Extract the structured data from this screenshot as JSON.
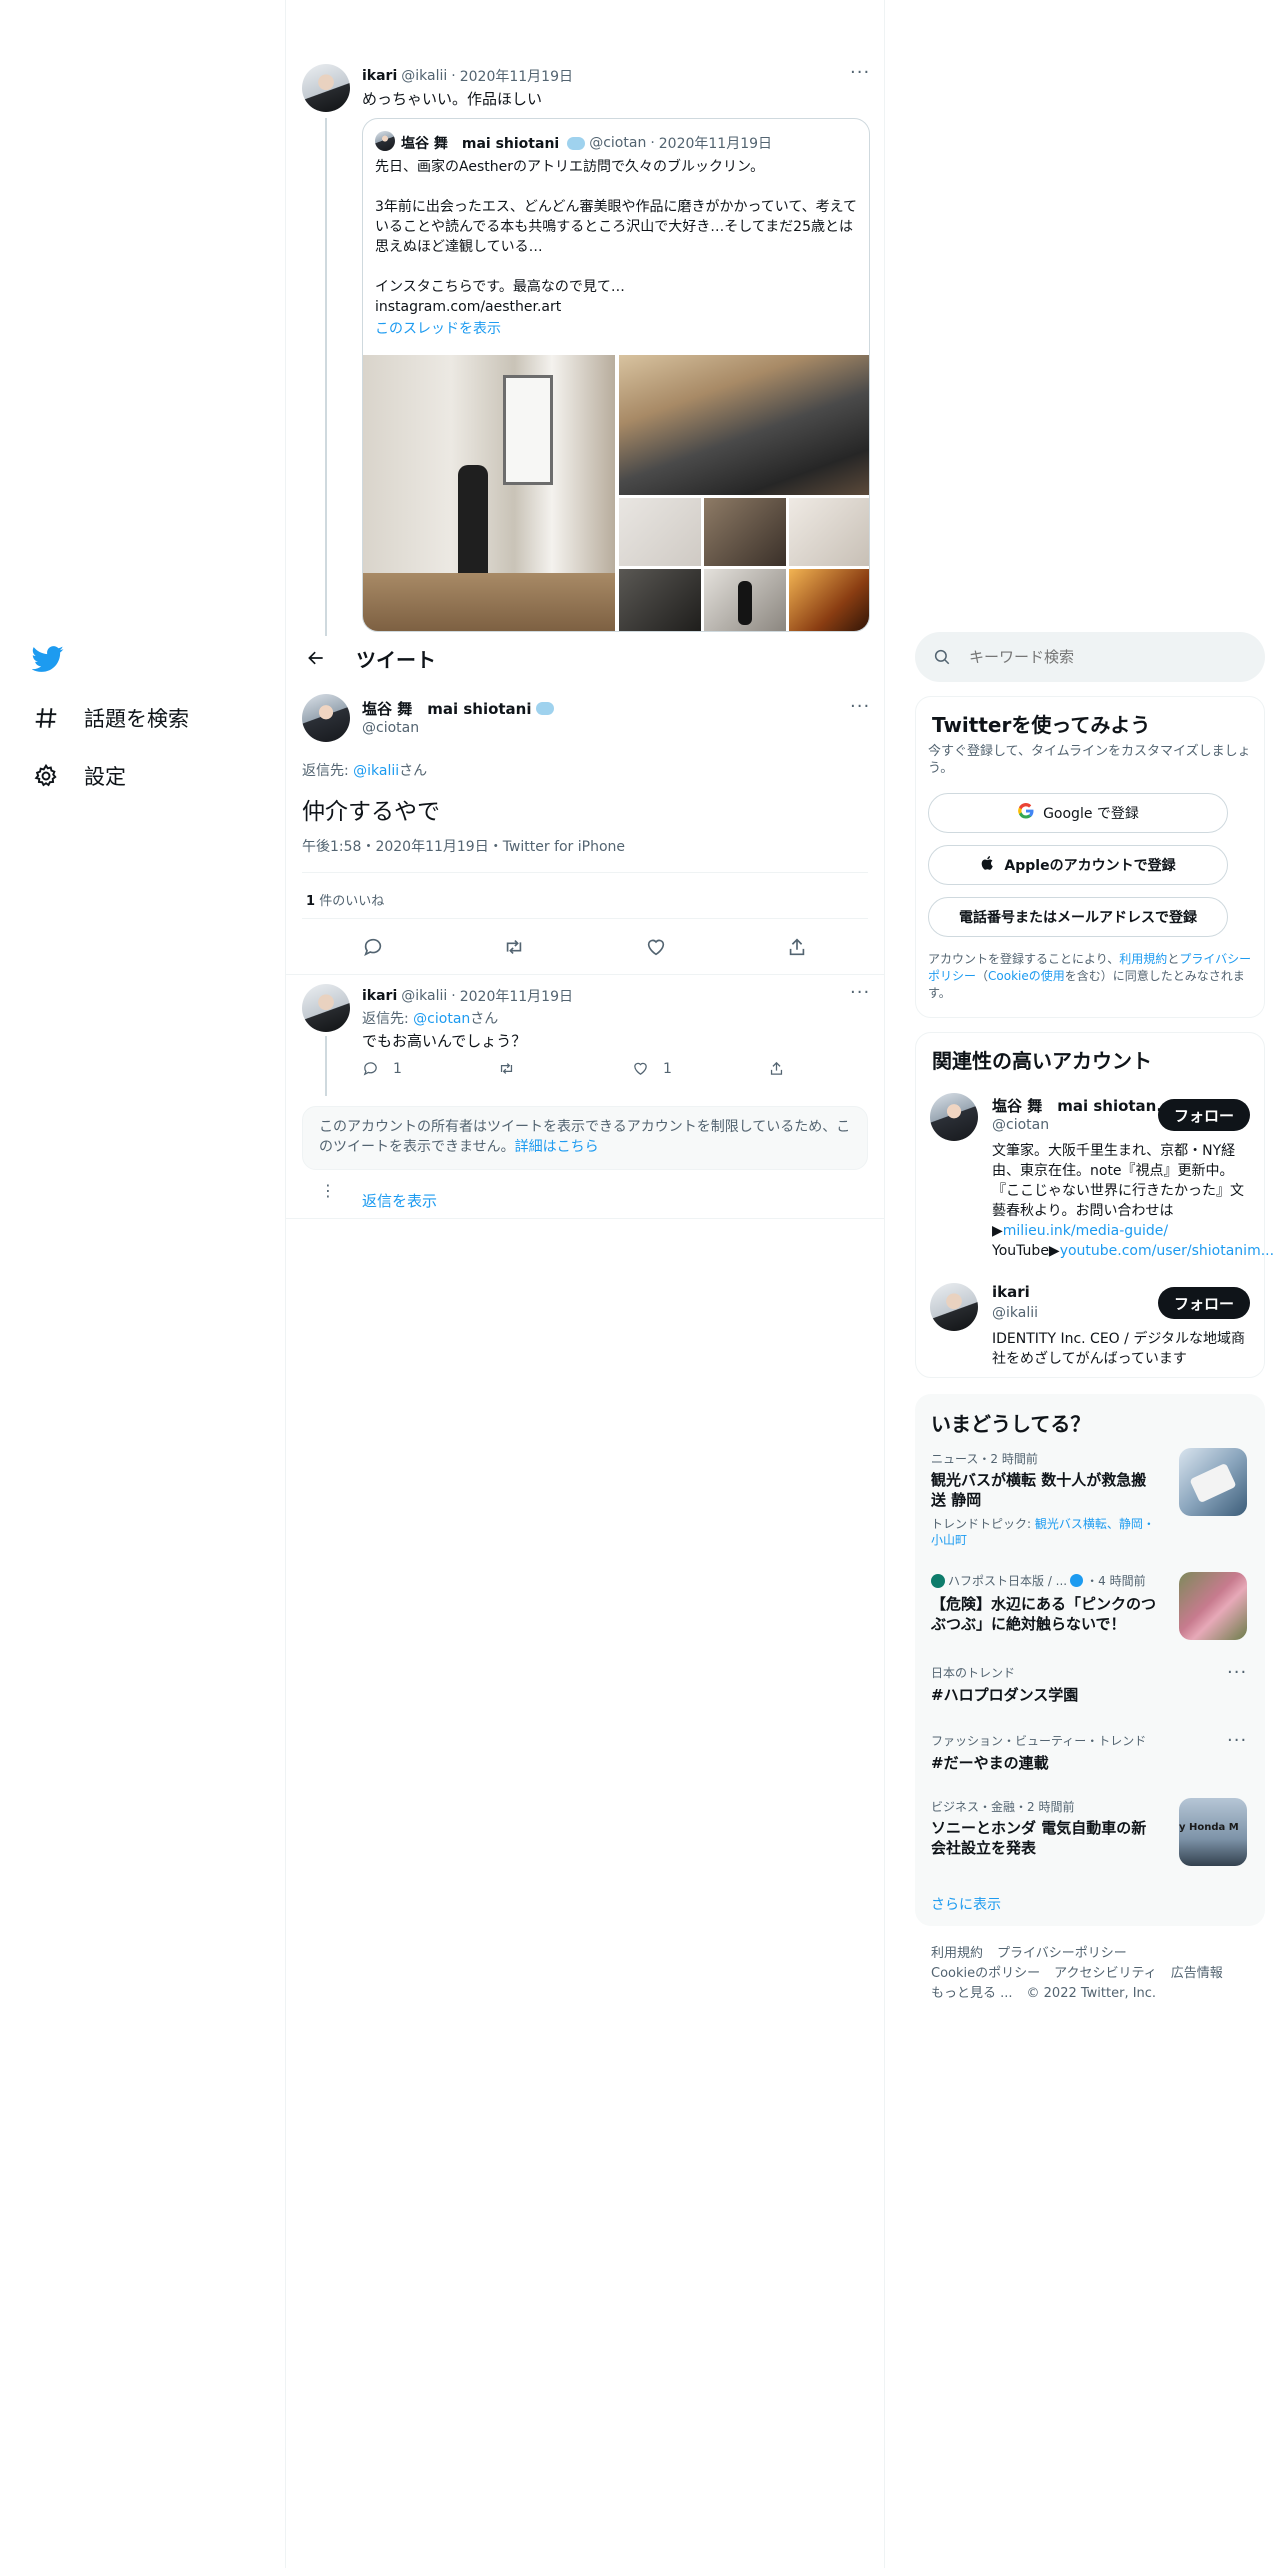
{
  "nav": {
    "items": [
      {
        "label": "話題を検索",
        "icon": "hashtag-icon"
      },
      {
        "label": "設定",
        "icon": "gear-icon"
      }
    ]
  },
  "top_tweet": {
    "name": "ikari",
    "handle": "@ikalii",
    "date": "2020年11月19日",
    "text": "めっちゃいい。作品ほしい",
    "quote": {
      "name": "塩谷 舞　mai shiotani",
      "handle": "@ciotan",
      "date": "2020年11月19日",
      "line1": "先日、画家のAestherのアトリエ訪問で久々のブルックリン。",
      "line2": "3年前に出会ったエス、どんどん審美眼や作品に磨きがかかっていて、考えていることや読んでる本も共鳴するところ沢山で大好き…そして",
      "line2b": "まだ25歳とは思えぬほど達観している…",
      "line3": "インスタこちらです。最高なので見て…",
      "line4": "instagram.com/aesther.art",
      "thread_link": "このスレッドを表示"
    }
  },
  "header": {
    "title": "ツイート"
  },
  "main_tweet": {
    "name": "塩谷 舞　mai shiotani",
    "handle": "@ciotan",
    "reply_prefix": "返信先: ",
    "reply_to": "@ikalii",
    "reply_suffix": "さん",
    "text": "仲介するやで",
    "meta": "午後1:58・2020年11月19日・Twitter for iPhone",
    "likes_count": "1",
    "likes_label": "件のいいね"
  },
  "reply_tweet": {
    "name": "ikari",
    "handle": "@ikalii",
    "date": "2020年11月19日",
    "reply_prefix": "返信先: ",
    "reply_to": "@ciotan",
    "reply_suffix": "さん",
    "text": "でもお高いんでしょう？",
    "reply_count": "1",
    "like_count": "1"
  },
  "restricted": {
    "text": "このアカウントの所有者はツイートを表示できるアカウントを制限しているため、このツイートを表示できません。",
    "link": "詳細はこちら"
  },
  "show_replies": "返信を表示",
  "search": {
    "placeholder": "キーワード検索"
  },
  "signup": {
    "title": "Twitterを使ってみよう",
    "subtitle": "今すぐ登録して、タイムラインをカスタマイズしましょう。",
    "google": "Google で登録",
    "apple": "Appleのアカウントで登録",
    "phone": "電話番号またはメールアドレスで登録",
    "terms_pre": "アカウントを登録することにより、",
    "terms_link1": "利用規約",
    "terms_and": "と",
    "terms_link2": "プライバシーポリシー",
    "terms_paren_open": "（",
    "terms_link3": "Cookieの使用",
    "terms_post": "を含む）に同意したとみなされます。"
  },
  "relevant": {
    "title": "関連性の高いアカウント",
    "accounts": [
      {
        "name": "塩谷 舞　mai shiotan...",
        "handle": "@ciotan",
        "follow": "フォロー",
        "bio": "文筆家。大阪千里生まれ、京都・NY経由、東京在住。note『視点』更新中。『ここじゃない世界に行きたかった』文藝春秋より。お問い合わせは▶",
        "bio_link1": "milieu.ink/media-guide/",
        "bio_mid": " YouTube▶",
        "bio_link2": "youtube.com/user/shiotanim..."
      },
      {
        "name": "ikari",
        "handle": "@ikalii",
        "follow": "フォロー",
        "bio": "IDENTITY Inc. CEO / デジタルな地域商社をめざしてがんばっています"
      }
    ]
  },
  "trends": {
    "title": "いまどうしてる？",
    "items": [
      {
        "meta": "ニュース・2 時間前",
        "title": "観光バスが横転 数十人が救急搬送 静岡",
        "topic_prefix": "トレンドトピック: ",
        "topic": "観光バス横転、静岡・小山町"
      },
      {
        "meta_source": "ハフポスト日本版 / ...",
        "meta_time": "・4 時間前",
        "title": "【危険】水辺にある「ピンクのつぶつぶ」に絶対触らないで！"
      },
      {
        "meta": "日本のトレンド",
        "title": "#ハロプロダンス学園"
      },
      {
        "meta": "ファッション・ビューティー・トレンド",
        "title": "#だーやまの連載"
      },
      {
        "meta": "ビジネス・金融・2 時間前",
        "title": "ソニーとホンダ 電気自動車の新会社設立を発表"
      }
    ],
    "thumb_text": "y Honda M",
    "more": "さらに表示"
  },
  "footer": {
    "links": [
      "利用規約",
      "プライバシーポリシー",
      "Cookieのポリシー",
      "アクセシビリティ",
      "広告情報",
      "もっと見る ..."
    ],
    "copyright": "© 2022 Twitter, Inc."
  },
  "colors": {
    "accent": "#1d9bf0",
    "text": "#0f1419",
    "muted": "#536471",
    "border": "#eff3f4"
  }
}
